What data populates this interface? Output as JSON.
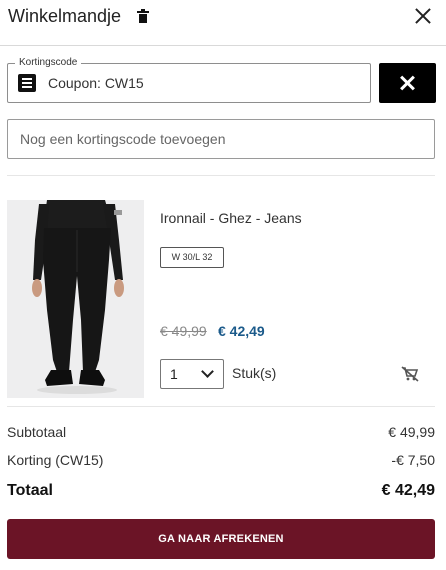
{
  "header": {
    "title": "Winkelmandje",
    "trash_icon": "trash-icon",
    "close_icon": "close-icon"
  },
  "coupon": {
    "legend": "Kortingscode",
    "icon": "coupon-list-icon",
    "value": "Coupon: CW15",
    "remove_icon": "close-icon"
  },
  "new_coupon": {
    "placeholder": "Nog een kortingscode toevoegen"
  },
  "item": {
    "image_alt": "jeans-product-photo",
    "name": "Ironnail - Ghez - Jeans",
    "size": "W 30/L 32",
    "old_price": "€ 49,99",
    "new_price": "€ 42,49",
    "quantity": "1",
    "unit": "Stuk(s)",
    "remove_icon": "remove-from-cart-icon"
  },
  "summary": {
    "subtotal_label": "Subtotaal",
    "subtotal_value": "€ 49,99",
    "discount_label": "Korting (CW15)",
    "discount_value": "-€ 7,50",
    "total_label": "Totaal",
    "total_value": "€ 42,49"
  },
  "checkout": {
    "label": "GA NAAR AFREKENEN"
  },
  "colors": {
    "accent": "#6b1426",
    "price": "#1b5a8a",
    "remove_button": "#000000"
  }
}
